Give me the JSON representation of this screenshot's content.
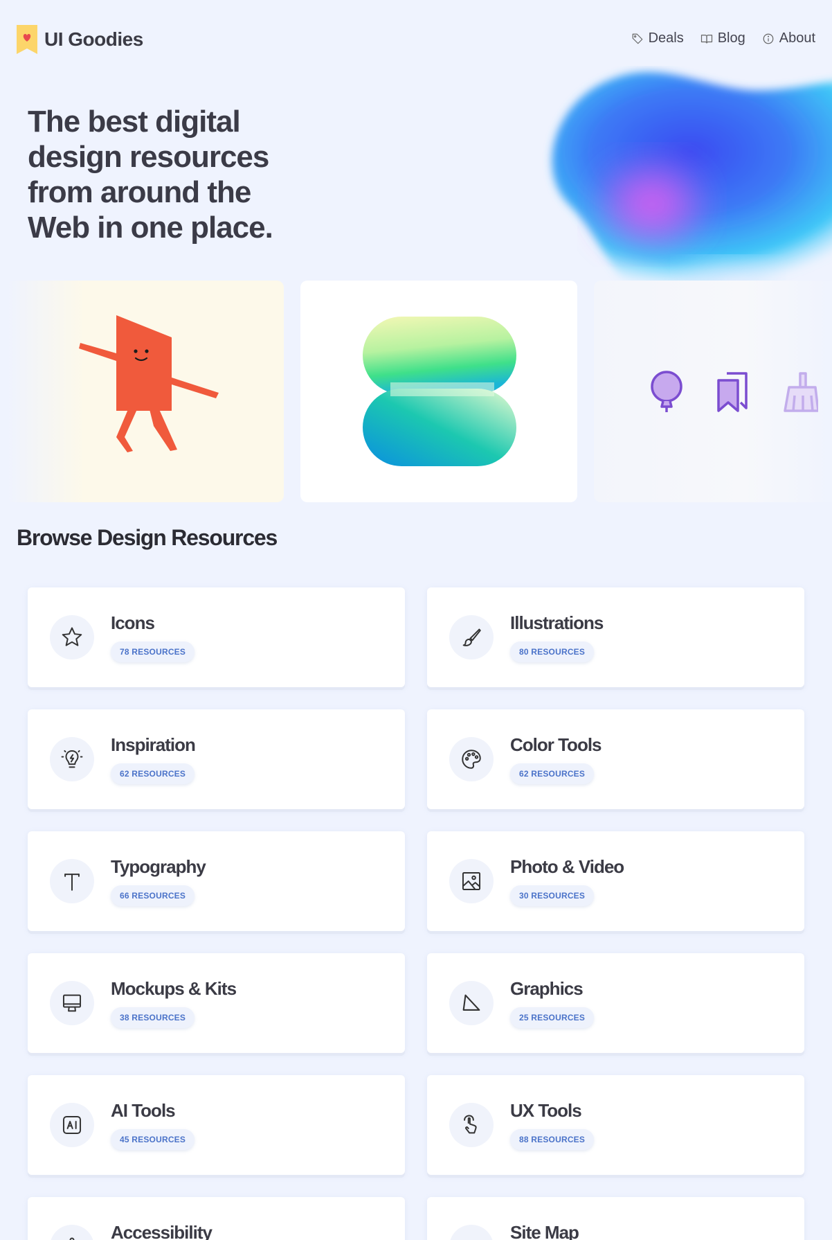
{
  "brand": {
    "name": "UI Goodies",
    "accent": "#fcd56a",
    "heart": "#e8484e"
  },
  "nav": [
    {
      "label": "Deals",
      "icon": "tag-icon"
    },
    {
      "label": "Blog",
      "icon": "book-icon"
    },
    {
      "label": "About",
      "icon": "info-icon"
    }
  ],
  "hero": {
    "lines": [
      "The best digital",
      "design resources",
      "from around the",
      "Web in one place."
    ]
  },
  "showcase": {
    "cards": [
      {
        "name": "illustration-character",
        "bg": "#fdf9ea",
        "figure_color": "#f05a3c"
      },
      {
        "name": "gradient-shape",
        "bg": "#ffffff"
      },
      {
        "name": "icon-set-preview",
        "icons": [
          "balloon-icon",
          "bookmarks-icon",
          "broom-icon"
        ],
        "icon_color": "#7b4dd0"
      }
    ]
  },
  "section": {
    "title": "Browse Design Resources"
  },
  "categories": [
    {
      "title": "Icons",
      "count": "78 RESOURCES",
      "icon": "star-icon"
    },
    {
      "title": "Illustrations",
      "count": "80 RESOURCES",
      "icon": "brush-icon"
    },
    {
      "title": "Inspiration",
      "count": "62 RESOURCES",
      "icon": "bulb-icon"
    },
    {
      "title": "Color Tools",
      "count": "62 RESOURCES",
      "icon": "palette-icon"
    },
    {
      "title": "Typography",
      "count": "66 RESOURCES",
      "icon": "type-icon"
    },
    {
      "title": "Photo & Video",
      "count": "30 RESOURCES",
      "icon": "photo-icon"
    },
    {
      "title": "Mockups & Kits",
      "count": "38 RESOURCES",
      "icon": "monitor-icon"
    },
    {
      "title": "Graphics",
      "count": "25 RESOURCES",
      "icon": "shape-icon"
    },
    {
      "title": "AI Tools",
      "count": "45 RESOURCES",
      "icon": "ai-icon"
    },
    {
      "title": "UX Tools",
      "count": "88 RESOURCES",
      "icon": "pointer-icon"
    },
    {
      "title": "Accessibility",
      "count": "",
      "icon": "accessibility-icon"
    },
    {
      "title": "Site Map",
      "count": "",
      "icon": "arrow-icon"
    }
  ],
  "colors": {
    "background": "#eff3fe",
    "badge_text": "#4b73c9",
    "badge_bg": "#eef2fc"
  }
}
